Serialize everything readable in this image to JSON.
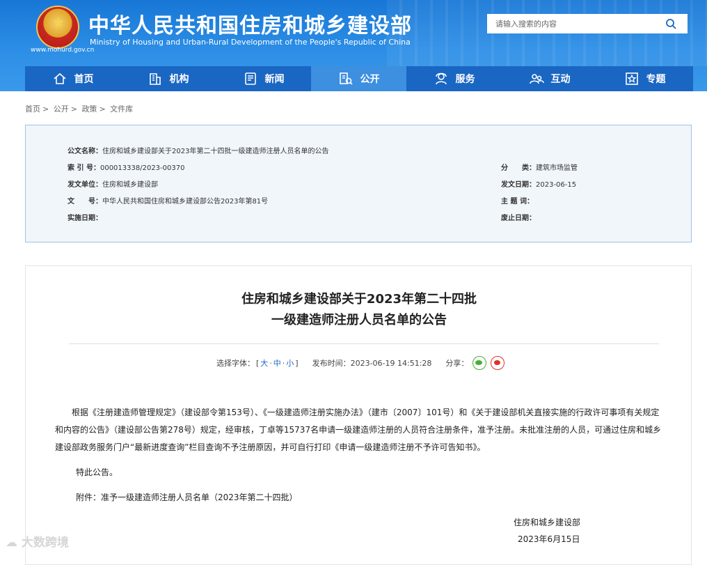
{
  "header": {
    "title_cn": "中华人民共和国住房和城乡建设部",
    "title_en": "Ministry of Housing and Urban-Rural Development of the People's Republic of China",
    "site_url": "www.mohurd.gov.cn",
    "search_placeholder": "请输入搜索的内容"
  },
  "nav": [
    {
      "label": "首页",
      "icon": "home-icon"
    },
    {
      "label": "机构",
      "icon": "building-icon"
    },
    {
      "label": "新闻",
      "icon": "news-icon"
    },
    {
      "label": "公开",
      "icon": "disclosure-icon",
      "active": true
    },
    {
      "label": "服务",
      "icon": "service-icon"
    },
    {
      "label": "互动",
      "icon": "interaction-icon"
    },
    {
      "label": "专题",
      "icon": "star-icon"
    }
  ],
  "breadcrumb": [
    "首页",
    "公开",
    "政策",
    "文件库"
  ],
  "meta": {
    "doc_name_key": "公文名称：",
    "doc_name": "住房和城乡建设部关于2023年第二十四批一级建造师注册人员名单的公告",
    "index_key": "索 引 号：",
    "index": "000013338/2023-00370",
    "category_key": "分　　类：",
    "category": "建筑市场监管",
    "issuer_key": "发文单位：",
    "issuer": "住房和城乡建设部",
    "issue_date_key": "发文日期：",
    "issue_date": "2023-06-15",
    "doc_no_key": "文　　号：",
    "doc_no": "中华人民共和国住房和城乡建设部公告2023年第81号",
    "subject_key": "主 题 词：",
    "subject": "",
    "effective_key": "实施日期：",
    "effective": "",
    "expiry_key": "废止日期：",
    "expiry": ""
  },
  "article": {
    "title_line1": "住房和城乡建设部关于2023年第二十四批",
    "title_line2": "一级建造师注册人员名单的公告",
    "font_label": "选择字体：",
    "font_open": "[",
    "font_large": "大",
    "font_medium": "中",
    "font_small": "小",
    "font_close": "]",
    "font_sep": "·",
    "publish_label": "发布时间：",
    "publish_time": "2023-06-19 14:51:28",
    "share_label": "分享：",
    "body": "根据《注册建造师管理规定》（建设部令第153号）、《一级建造师注册实施办法》（建市〔2007〕101号）和《关于建设部机关直接实施的行政许可事项有关规定和内容的公告》（建设部公告第278号）规定，经审核，丁卓等15737名申请一级建造师注册的人员符合注册条件，准予注册。未批准注册的人员，可通过住房和城乡建设部政务服务门户“最新进度查询”栏目查询不予注册原因，并可自行打印《申请一级建造师注册不予许可告知书》。",
    "notice": "特此公告。",
    "attachment": "附件：准予一级建造师注册人员名单（2023年第二十四批）",
    "signature": "住房和城乡建设部",
    "date": "2023年6月15日"
  },
  "watermark": "大数跨境"
}
